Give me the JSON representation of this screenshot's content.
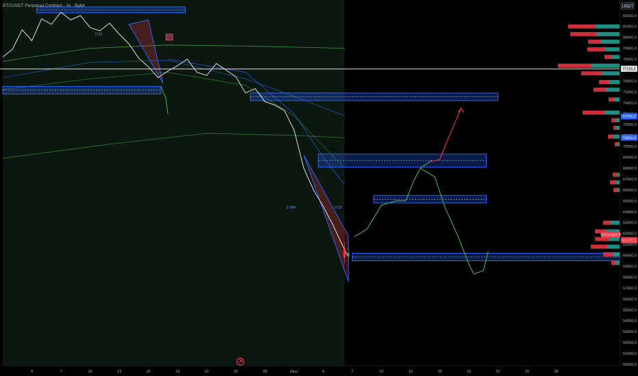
{
  "chart_data": {
    "type": "line",
    "title": "BTCUSDT Perpetual Contract · 1ч · Bybit",
    "currency": "USDT",
    "ylim": [
      50000,
      82800
    ],
    "y_ticks": [
      82000,
      81000,
      80000,
      79000,
      78000,
      77000,
      76000,
      75000,
      74000,
      73000,
      72000,
      71000,
      70000,
      69000,
      68000,
      67000,
      66000,
      65000,
      64000,
      63000,
      62000,
      61000,
      60000,
      59000,
      58000,
      57000,
      56000,
      55000,
      54000,
      53000,
      52000,
      51000,
      50000
    ],
    "y_tick_labels": [
      "82000,0",
      "81000,0",
      "80000,0",
      "79000,0",
      "78000,0",
      "77000,0",
      "76000,0",
      "75000,0",
      "74000,0",
      "73000,0",
      "72000,0",
      "71000,0",
      "70000,0",
      "69000,0",
      "68000,0",
      "67000,0",
      "66000,0",
      "65000,0",
      "64000,0",
      "63000,0",
      "62000,0",
      "61000,0",
      "60000,0",
      "59000,0",
      "58000,0",
      "57000,0",
      "56000,0",
      "55000,0",
      "54000,0",
      "53000,0",
      "52000,0",
      "51000,0",
      "50000,0"
    ],
    "x_ticks": [
      {
        "label": "4",
        "t": 4
      },
      {
        "label": "7",
        "t": 7
      },
      {
        "label": "10",
        "t": 10
      },
      {
        "label": "13",
        "t": 13
      },
      {
        "label": "16",
        "t": 16
      },
      {
        "label": "19",
        "t": 19
      },
      {
        "label": "22",
        "t": 22
      },
      {
        "label": "25",
        "t": 25
      },
      {
        "label": "28",
        "t": 28
      },
      {
        "label": "Июн",
        "t": 31
      },
      {
        "label": "4",
        "t": 34
      },
      {
        "label": "7",
        "t": 37
      },
      {
        "label": "10",
        "t": 40
      },
      {
        "label": "13",
        "t": 43
      },
      {
        "label": "16",
        "t": 46
      },
      {
        "label": "19",
        "t": 49
      },
      {
        "label": "22",
        "t": 52
      },
      {
        "label": "25",
        "t": 55
      },
      {
        "label": "28",
        "t": 58
      }
    ],
    "xlim": [
      1,
      64.8
    ],
    "price_path": [
      [
        1,
        78200
      ],
      [
        2,
        78900
      ],
      [
        3,
        80700
      ],
      [
        4,
        79700
      ],
      [
        5,
        81700
      ],
      [
        6,
        81200
      ],
      [
        7,
        82300
      ],
      [
        8,
        81600
      ],
      [
        9,
        82000
      ],
      [
        10,
        80900
      ],
      [
        11,
        80600
      ],
      [
        12,
        81300
      ],
      [
        13,
        80300
      ],
      [
        14,
        79400
      ],
      [
        15,
        78100
      ],
      [
        16,
        77300
      ],
      [
        17,
        76300
      ],
      [
        18,
        76900
      ],
      [
        19,
        77400
      ],
      [
        20,
        78000
      ],
      [
        21,
        76800
      ],
      [
        22,
        76500
      ],
      [
        23,
        77600
      ],
      [
        24,
        77000
      ],
      [
        25,
        76400
      ],
      [
        26,
        74900
      ],
      [
        27,
        75300
      ],
      [
        28,
        74100
      ],
      [
        29,
        73800
      ],
      [
        30,
        73300
      ],
      [
        31,
        71500
      ],
      [
        32,
        68000
      ],
      [
        33,
        66000
      ],
      [
        34,
        64500
      ],
      [
        35,
        62800
      ],
      [
        36,
        60900
      ],
      [
        36.5,
        60000
      ]
    ],
    "candles": [
      {
        "t": 36.2,
        "open": 60600,
        "close": 59800,
        "high": 61200,
        "low": 59300
      },
      {
        "t": 36.6,
        "open": 59900,
        "close": 60200,
        "high": 60700,
        "low": 59500
      }
    ],
    "levels": {
      "current_price": 77116.2,
      "horizontal_line": 77100
    },
    "price_labels": [
      {
        "label": "77116,2",
        "value": 77116.2,
        "color": "#e0e0e0",
        "text_color": "#000000"
      },
      {
        "label": "72753,2",
        "value": 72753.2,
        "color": "#2962ff",
        "text_color": "#ffffff"
      },
      {
        "label": "70804,0",
        "value": 70804.0,
        "color": "#2962ff",
        "text_color": "#ffffff"
      },
      {
        "label": "BTCUSDT.P",
        "value": 61900,
        "color": "#f23645",
        "text_color": "#ffffff"
      },
      {
        "label": "61377,1",
        "value": 61900,
        "color": "#f23645",
        "text_color": "#ffffff"
      }
    ],
    "zones": [
      {
        "t0": 4.5,
        "t1": 19.8,
        "top": 82800,
        "bottom": 82250
      },
      {
        "t0": 1,
        "t1": 17.3,
        "top": 75500,
        "bottom": 74800
      },
      {
        "t0": 26.5,
        "t1": 52,
        "top": 74900,
        "bottom": 74200
      },
      {
        "t0": 33.5,
        "t1": 50.8,
        "top": 69300,
        "bottom": 68100
      },
      {
        "t0": 39.2,
        "t1": 50.8,
        "top": 65500,
        "bottom": 64800
      },
      {
        "t0": 37,
        "t1": 65.5,
        "top": 60200,
        "bottom": 59500
      }
    ],
    "fib_labels": [
      {
        "label": "0.92",
        "t": 10.5,
        "value": 80200
      },
      {
        "label": "0.894",
        "t": 30.2,
        "value": 64300
      },
      {
        "label": "0.92",
        "t": 35.2,
        "value": 64300
      }
    ],
    "forecast_paths": [
      {
        "color": "#4caf50",
        "points": [
          [
            37.2,
            61700
          ],
          [
            38.5,
            62400
          ],
          [
            40,
            64600
          ],
          [
            41.5,
            65000
          ],
          [
            42.5,
            65000
          ],
          [
            43.3,
            66800
          ],
          [
            44,
            68000
          ],
          [
            45,
            68600
          ]
        ]
      },
      {
        "color": "#f23645",
        "points": [
          [
            45,
            68600
          ],
          [
            46,
            68800
          ],
          [
            47,
            71000
          ],
          [
            48.2,
            73500
          ]
        ]
      },
      {
        "color": "#4caf50",
        "points": [
          [
            44,
            68000
          ],
          [
            45.5,
            67200
          ],
          [
            46.5,
            64500
          ],
          [
            48,
            61500
          ],
          [
            49,
            59200
          ],
          [
            49.5,
            58300
          ],
          [
            50.5,
            58600
          ],
          [
            51,
            60400
          ]
        ]
      }
    ],
    "volume_profile": [
      {
        "value": 81000,
        "down": 40,
        "up": 35
      },
      {
        "value": 80300,
        "down": 38,
        "up": 34
      },
      {
        "value": 79600,
        "down": 18,
        "up": 28
      },
      {
        "value": 78900,
        "down": 25,
        "up": 22
      },
      {
        "value": 78200,
        "down": 10,
        "up": 12
      },
      {
        "value": 77400,
        "down": 48,
        "up": 42
      },
      {
        "value": 76700,
        "down": 30,
        "up": 26
      },
      {
        "value": 75900,
        "down": 14,
        "up": 16
      },
      {
        "value": 75200,
        "down": 18,
        "up": 20
      },
      {
        "value": 74300,
        "down": 8,
        "up": 8
      },
      {
        "value": 73100,
        "down": 32,
        "up": 22
      },
      {
        "value": 72400,
        "down": 6,
        "up": 6
      },
      {
        "value": 71700,
        "down": 4,
        "up": 5
      },
      {
        "value": 70900,
        "down": 8,
        "up": 9
      },
      {
        "value": 70200,
        "down": 3,
        "up": 4
      },
      {
        "value": 67400,
        "down": 6,
        "up": 4
      },
      {
        "value": 66700,
        "down": 8,
        "up": 6
      },
      {
        "value": 66000,
        "down": 5,
        "up": 4
      },
      {
        "value": 63000,
        "down": 10,
        "up": 14
      },
      {
        "value": 62200,
        "down": 16,
        "up": 20
      },
      {
        "value": 61500,
        "down": 20,
        "up": 16
      },
      {
        "value": 60800,
        "down": 24,
        "up": 18
      },
      {
        "value": 60100,
        "down": 14,
        "up": 10
      },
      {
        "value": 59300,
        "down": 6,
        "up": 6
      }
    ],
    "colors": {
      "up": "#26a69a",
      "down": "#f23645",
      "zone": "#2962ff",
      "ma": "#4caf50",
      "band": "#2962ff"
    }
  }
}
